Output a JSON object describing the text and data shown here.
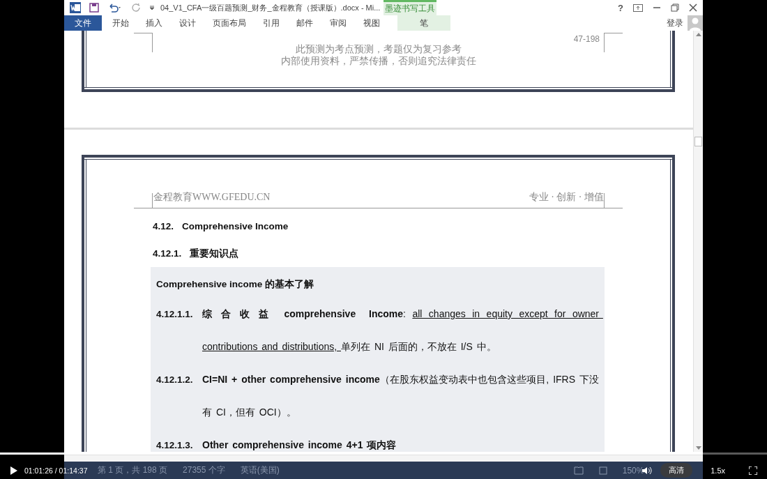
{
  "window": {
    "title": "04_V1_CFA一级百题预测_财务_金程教育（授课版）.docx - Mi...",
    "contextual_group": "墨迹书写工具",
    "help": "?"
  },
  "ribbon_tabs": [
    {
      "label": "文件",
      "kind": "file",
      "selected": false
    },
    {
      "label": "开始",
      "kind": "normal",
      "selected": false
    },
    {
      "label": "插入",
      "kind": "normal",
      "selected": false
    },
    {
      "label": "设计",
      "kind": "normal",
      "selected": false
    },
    {
      "label": "页面布局",
      "kind": "normal",
      "selected": false
    },
    {
      "label": "引用",
      "kind": "normal",
      "selected": false
    },
    {
      "label": "邮件",
      "kind": "normal",
      "selected": false
    },
    {
      "label": "审阅",
      "kind": "normal",
      "selected": false
    },
    {
      "label": "视图",
      "kind": "normal",
      "selected": false
    },
    {
      "label": "笔",
      "kind": "contextual",
      "selected": false
    }
  ],
  "account": {
    "label": "登录"
  },
  "page_footer": {
    "page_number": "47-198",
    "notice": [
      "此预测为考点预测，考题仅为复习参考",
      "内部使用资料，严禁传播，否则追究法律责任"
    ]
  },
  "page_header": {
    "left": "金程教育WWW.GFEDU.CN",
    "right": "专业 · 创新 · 增值"
  },
  "section": {
    "heading_number": "4.12.",
    "heading": "Comprehensive Income",
    "subheading_number": "4.12.1.",
    "subheading": "重要知识点"
  },
  "box": {
    "title": "Comprehensive income 的基本了解",
    "items": [
      {
        "number": "4.12.1.1.",
        "segments": [
          {
            "kind": "bold",
            "text": "综 合 收 益  comprehensive  Income"
          },
          {
            "kind": "plain",
            "text": ": "
          },
          {
            "kind": "underline",
            "text": "all changes in equity except for owner contributions and distributions, "
          },
          {
            "kind": "plain",
            "text": "单列在 NI 后面的，不放在 I/S 中。"
          }
        ]
      },
      {
        "number": "4.12.1.2.",
        "segments": [
          {
            "kind": "bold",
            "text": "CI=NI + other comprehensive income"
          },
          {
            "kind": "plain",
            "text": "（在股东权益变动表中也包含这些项目, IFRS 下没有 CI，但有 OCI）。"
          }
        ]
      },
      {
        "number": "4.12.1.3.",
        "segments": [
          {
            "kind": "bold",
            "text": "Other comprehensive income 4+1 项内容"
          }
        ]
      }
    ]
  },
  "status_bar": {
    "page": "第 1 页，共 198 页",
    "words": "27355 个字",
    "language": "英语(美国)",
    "zoom": "150%"
  },
  "player": {
    "time": "01:01:26 / 01:14:37",
    "quality": "高清",
    "speed": "1.5x",
    "progress": {
      "level": 0.823
    }
  }
}
